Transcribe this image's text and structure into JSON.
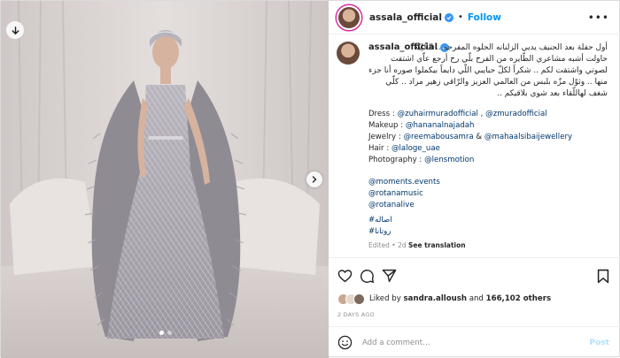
{
  "header": {
    "username": "assala_official",
    "separator": "•",
    "follow_label": "Follow",
    "more_label": "•••"
  },
  "caption": {
    "username": "assala_official",
    "arabic_lines": [
      "أول حفلة بعد الحنيف يديي الزلنانه الحلوه المفرحه .. الخُلِيّه",
      "حاولت أشبه مشاعري الطّايره من الفرح بلّي رح أرجع عاّي اشتفت",
      "لصوتي واشتقت لكم .. شكراً لكلّ حبايبي اللّي دايماً بيكملوا صوره أنا جزء",
      "منها .. وثوّل مزّه بلبس من العالمي العزيز والرّاقي زهير مراد .. كلّي",
      "شغف لهاللّقاء بعد شوي بلاقيكم .."
    ],
    "credits": [
      {
        "label": "Dress : ",
        "tags": [
          "@zuhairmuradofficial",
          "@zmuradofficial"
        ],
        "joiner": " , "
      },
      {
        "label": "Makeup : ",
        "tags": [
          "@hananalnajadah"
        ],
        "joiner": ""
      },
      {
        "label": "Jewelry : ",
        "tags": [
          "@reemabousamra",
          "@mahaalsibaijewellery"
        ],
        "joiner": " & "
      },
      {
        "label": "Hair : ",
        "tags": [
          "@laloge_uae"
        ],
        "joiner": ""
      },
      {
        "label": "Photography : ",
        "tags": [
          "@lensmotion"
        ],
        "joiner": ""
      }
    ],
    "mentions": [
      "@moments.events",
      "@rotanamusic",
      "@rotanalive"
    ],
    "hashtags": [
      "#اصاله",
      "#روتانا"
    ],
    "meta_edited": "Edited",
    "meta_time": "2d",
    "meta_sep": "•",
    "meta_translation": "See translation"
  },
  "likes": {
    "prefix": "Liked by ",
    "user": "sandra.alloush",
    "middle": " and ",
    "count": "166,102 others"
  },
  "timestamp": "2 DAYS AGO",
  "comment": {
    "placeholder": "Add a comment…",
    "post_label": "Post"
  },
  "colors": {
    "link": "#00376b",
    "follow": "#0095f6",
    "verified": "#3897f0",
    "muted": "#8e8e8e"
  },
  "carousel": {
    "slides": 2,
    "current": 1
  }
}
